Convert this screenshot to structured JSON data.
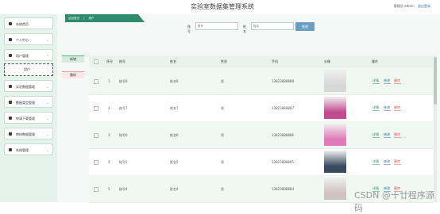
{
  "header": {
    "title": "实验室数据集管理系统",
    "user_label": "管理员 admin",
    "logout_label": "退出登录"
  },
  "sidebar": {
    "items": [
      {
        "label": "系统首页",
        "icon": "home-icon"
      },
      {
        "label": "个人中心",
        "icon": "person-icon"
      },
      {
        "label": "用户管理",
        "icon": "users-icon"
      },
      {
        "label": "实验数据管理",
        "icon": "data-icon"
      },
      {
        "label": "数据类型管理",
        "icon": "type-icon"
      },
      {
        "label": "申请下载管理",
        "icon": "download-icon"
      },
      {
        "label": "审核数据管理",
        "icon": "audit-icon"
      },
      {
        "label": "系统管理",
        "icon": "settings-icon"
      }
    ],
    "submenu_item": "用户"
  },
  "breadcrumb": {
    "home": "后台首页",
    "current": "用户"
  },
  "search": {
    "field1_label": "账号",
    "field1_placeholder": "账号",
    "field2_label": "姓名",
    "field2_placeholder": "姓名",
    "button_label": "查询"
  },
  "actions": {
    "add_label": "新增",
    "delete_label": "删除"
  },
  "table": {
    "headers": [
      "",
      "序号",
      "账号",
      "姓名",
      "性别",
      "手机",
      "头像",
      "操作"
    ],
    "rows": [
      {
        "index": "1",
        "account": "账号8",
        "name": "姓名8",
        "gender": "男",
        "phone": "13823888888",
        "photo_color": "#d7d7d7"
      },
      {
        "index": "2",
        "account": "账号7",
        "name": "姓名7",
        "gender": "男",
        "phone": "13823888887",
        "photo_color": "#c44a8f"
      },
      {
        "index": "3",
        "account": "账号6",
        "name": "姓名6",
        "gender": "男",
        "phone": "13823888886",
        "photo_color": "#e07ab8"
      },
      {
        "index": "4",
        "account": "账号5",
        "name": "姓名5",
        "gender": "男",
        "phone": "13823888885",
        "photo_color": "#3a4a5e"
      },
      {
        "index": "5",
        "account": "账号4",
        "name": "姓名4",
        "gender": "男",
        "phone": "13823888884",
        "photo_color": "#cfc3c1"
      }
    ],
    "row_actions": {
      "detail": "详情",
      "edit": "修改",
      "delete": "删除"
    }
  },
  "watermark": "CSDN @十廿程序源码"
}
